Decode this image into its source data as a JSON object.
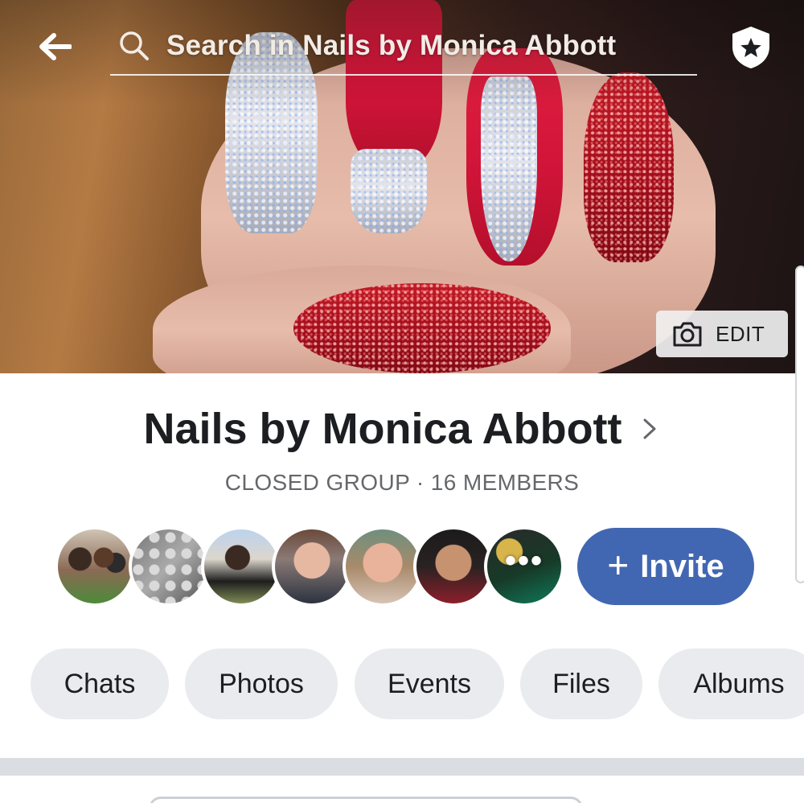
{
  "header": {
    "back_icon": "back-arrow-icon",
    "search_placeholder": "Search in Nails by Monica Abbott",
    "badge_icon": "admin-star-shield-icon"
  },
  "cover": {
    "edit_label": "EDIT",
    "edit_icon": "camera-icon"
  },
  "group": {
    "name": "Nails by Monica Abbott",
    "meta": "CLOSED GROUP · 16 MEMBERS",
    "more_indicator": "•••"
  },
  "invite": {
    "label": "Invite",
    "icon": "plus-icon"
  },
  "tabs": [
    "Chats",
    "Photos",
    "Events",
    "Files",
    "Albums"
  ],
  "colors": {
    "accent": "#4267b2",
    "chip_bg": "#e9ebee",
    "text": "#1c1e21",
    "meta_text": "#65676b"
  }
}
